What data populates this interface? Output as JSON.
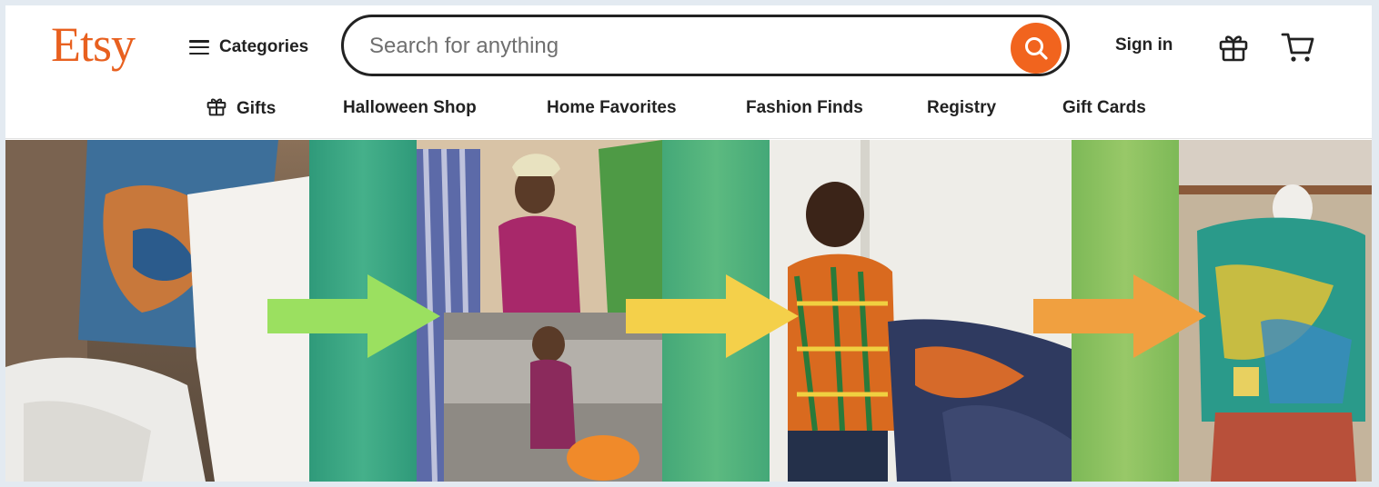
{
  "brand": {
    "name": "Etsy",
    "color": "#e8601f"
  },
  "header": {
    "categories_label": "Categories",
    "categories_icon": "hamburger-menu-icon",
    "search_placeholder": "Search for anything",
    "search_icon": "search-icon",
    "search_button_color": "#f1641e",
    "signin_label": "Sign in",
    "gift_icon": "gift-icon",
    "cart_icon": "cart-icon"
  },
  "nav": {
    "items": [
      {
        "label": "Gifts",
        "icon": "gift-icon"
      },
      {
        "label": "Halloween Shop"
      },
      {
        "label": "Home Favorites"
      },
      {
        "label": "Fashion Finds"
      },
      {
        "label": "Registry"
      },
      {
        "label": "Gift Cards"
      }
    ]
  },
  "banner": {
    "arrow_colors": [
      "#9be060",
      "#f4d04a",
      "#f0a040"
    ],
    "divider_colors": [
      "#3aa585",
      "#4fb07a",
      "#8cc260"
    ]
  }
}
